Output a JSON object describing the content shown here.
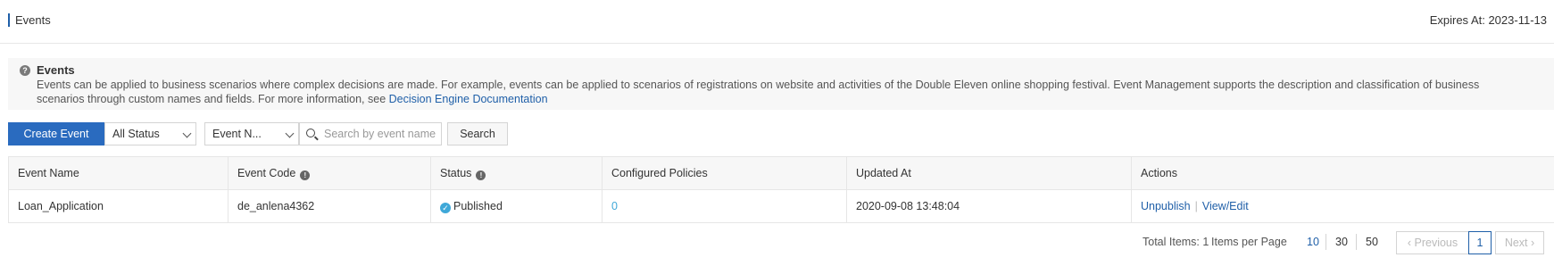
{
  "header": {
    "title": "Events",
    "expires": "Expires At: 2023-11-13"
  },
  "info": {
    "title": "Events",
    "text": "Events can be applied to business scenarios where complex decisions are made. For example, events can be applied to scenarios of registrations on website and activities of the Double Eleven online shopping festival. Event Management supports the description and classification of business scenarios through custom names and fields. For more information, see ",
    "link": "Decision Engine Documentation"
  },
  "toolbar": {
    "create_label": "Create Event",
    "status_select": "All Status",
    "field_select": "Event N...",
    "search_placeholder": "Search by event name",
    "search_label": "Search"
  },
  "table": {
    "headers": [
      "Event Name",
      "Event Code",
      "Status",
      "Configured Policies",
      "Updated At",
      "Actions"
    ],
    "rows": [
      {
        "event_name": "Loan_Application",
        "event_code": "de_anlena4362",
        "status": "Published",
        "configured_policies": "0",
        "updated_at": "2020-09-08 13:48:04",
        "actions": [
          "Unpublish",
          "View/Edit"
        ]
      }
    ]
  },
  "pagination": {
    "total": "Total Items: 1",
    "items_per_page_label": "Items per Page",
    "page_sizes": [
      "10",
      "30",
      "50"
    ],
    "selected_page_size": "10",
    "prev": "Previous",
    "current": "1",
    "next": "Next"
  },
  "colors": {
    "primary": "#2a6bbf",
    "link": "#1f5fa8",
    "status_published": "#3fa8d8"
  }
}
